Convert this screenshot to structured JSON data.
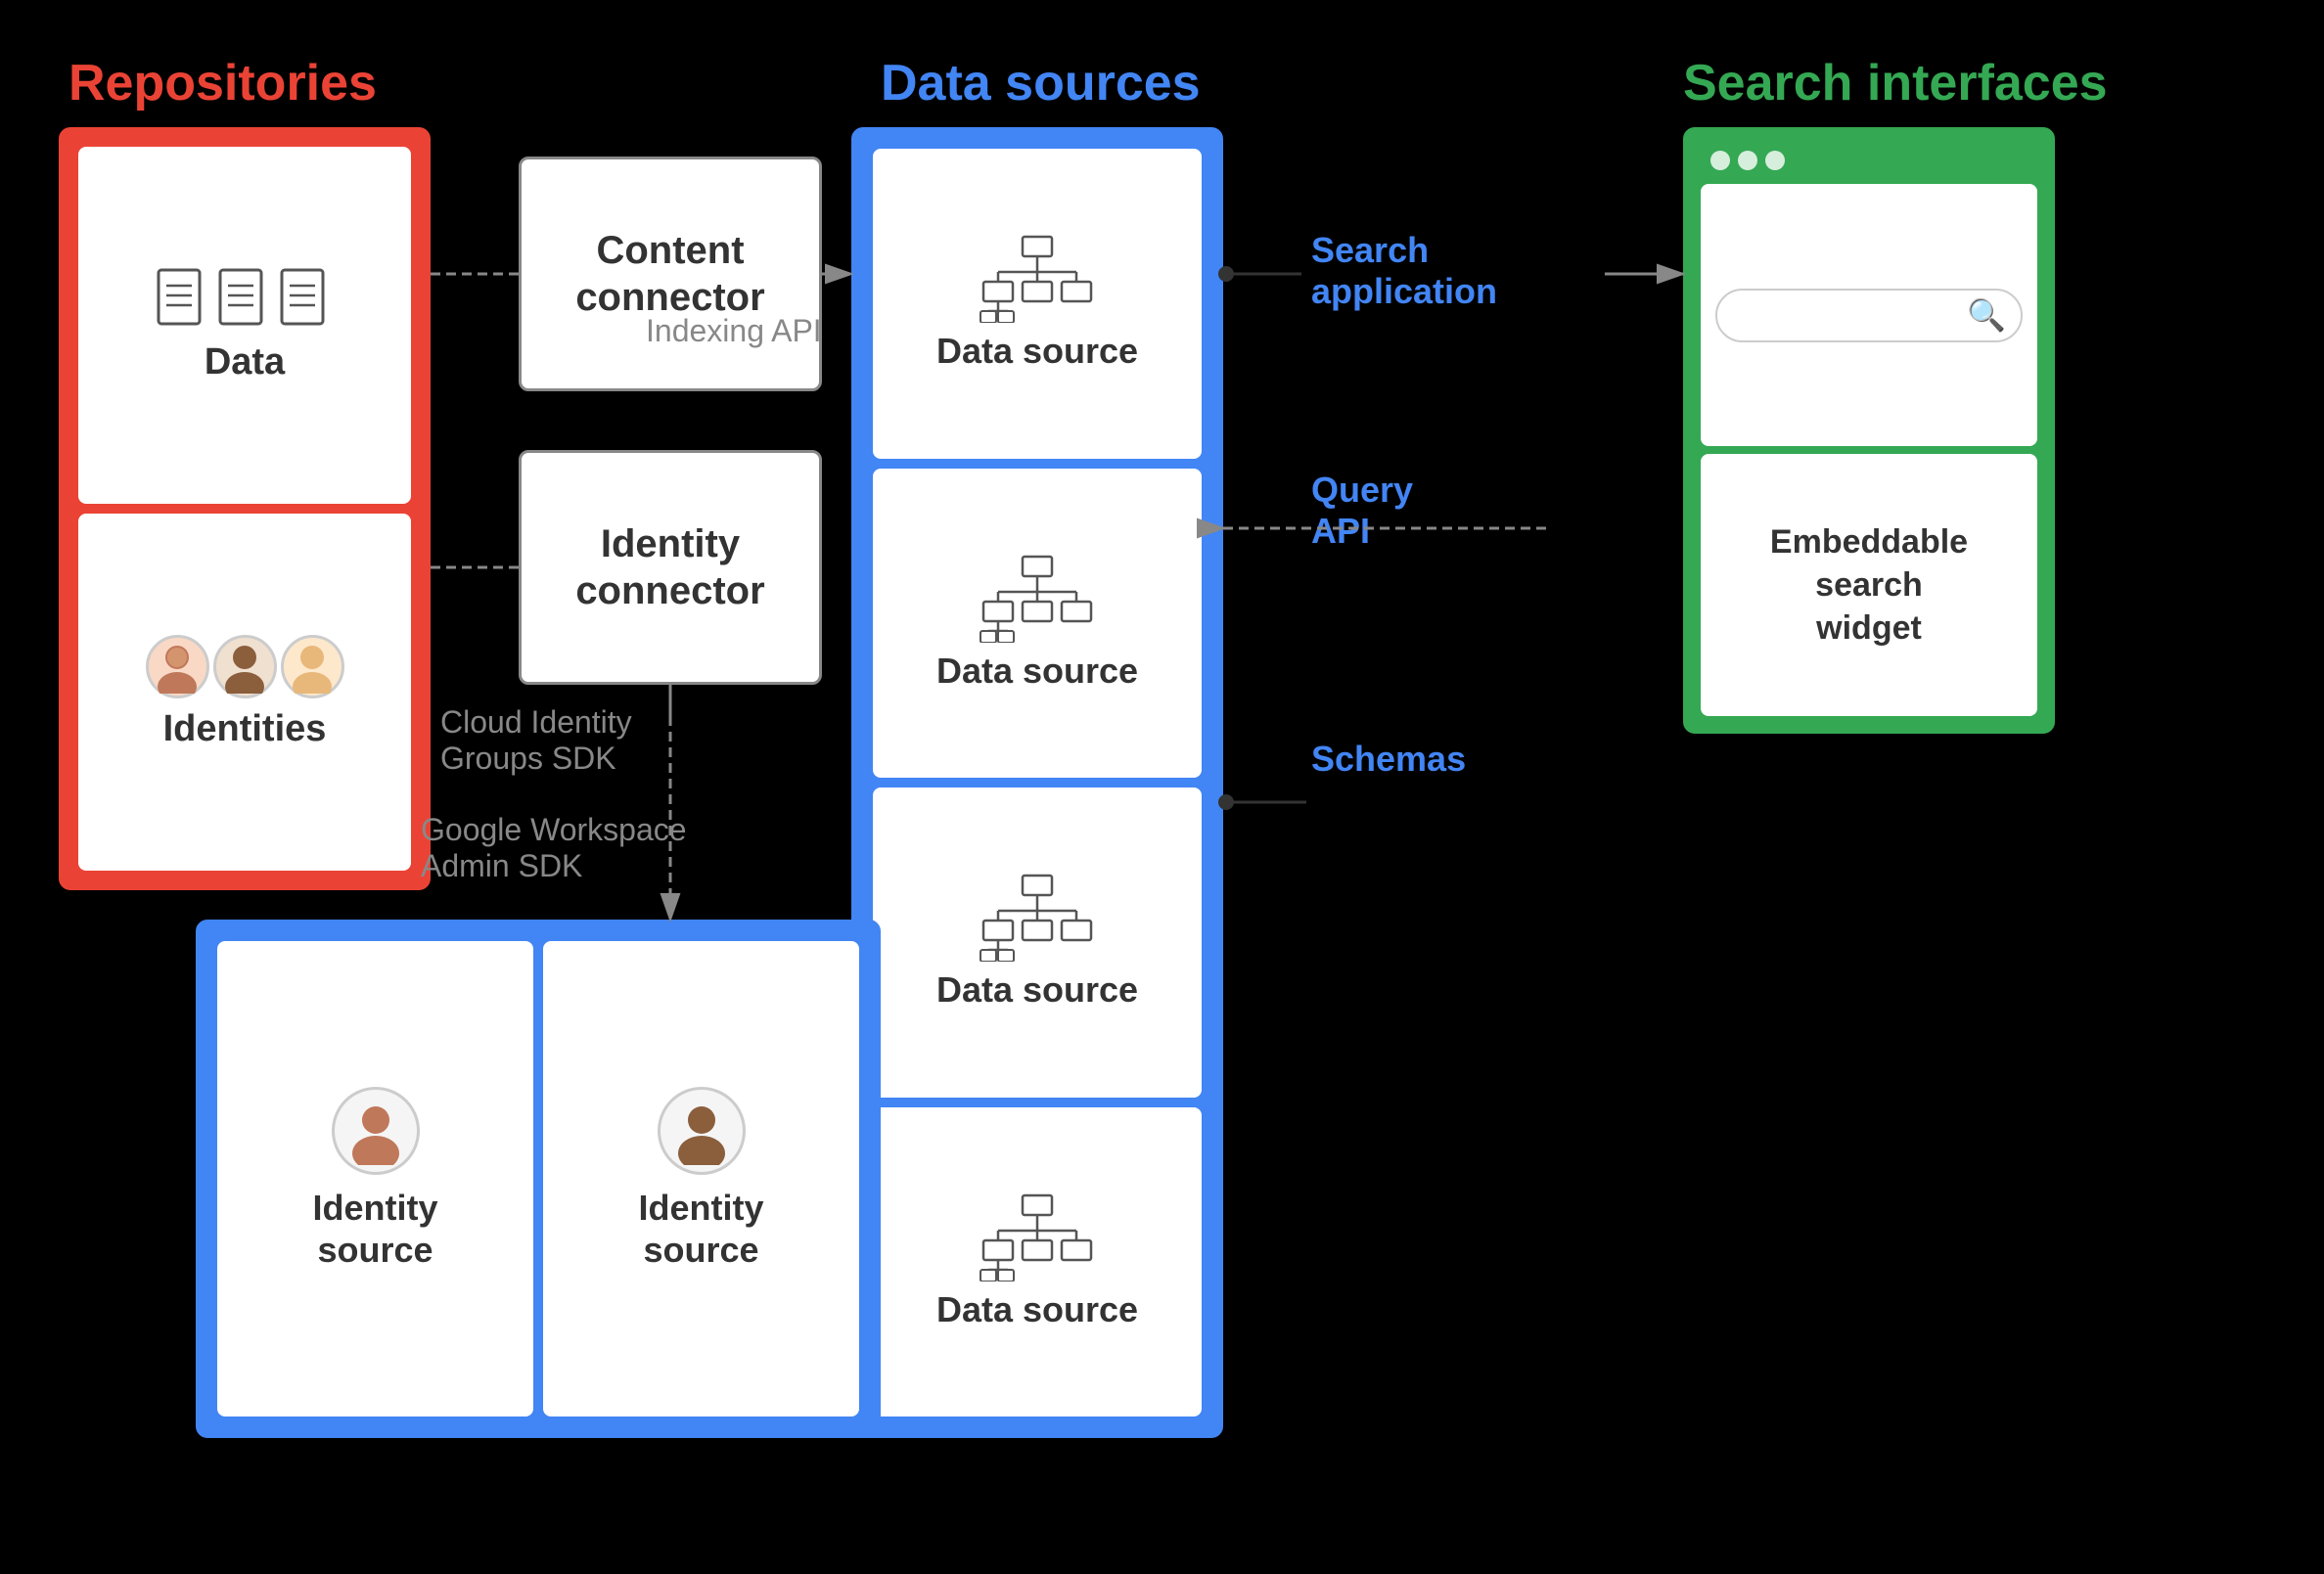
{
  "labels": {
    "repositories": "Repositories",
    "data_sources": "Data sources",
    "search_interfaces": "Search interfaces"
  },
  "repositories": {
    "data_box_label": "Data",
    "identities_box_label": "Identities"
  },
  "connectors": {
    "content_connector": "Content\nconnector",
    "identity_connector": "Identity\nconnector"
  },
  "data_sources": {
    "items": [
      "Data source",
      "Data source",
      "Data source",
      "Data source"
    ]
  },
  "search_interfaces": {
    "search_label": "Search",
    "widget_label": "Embeddable\nsearch\nwidget"
  },
  "identity_sources": {
    "items": [
      "Identity\nsource",
      "Identity\nsource"
    ]
  },
  "arrow_labels": {
    "indexing_api": "Indexing API",
    "cloud_identity": "Cloud Identity\nGroups SDK",
    "google_workspace": "Google Workspace\nAdmin SDK",
    "query_api": "Query\nAPI",
    "search_application": "Search\napplication",
    "schemas": "Schemas"
  }
}
